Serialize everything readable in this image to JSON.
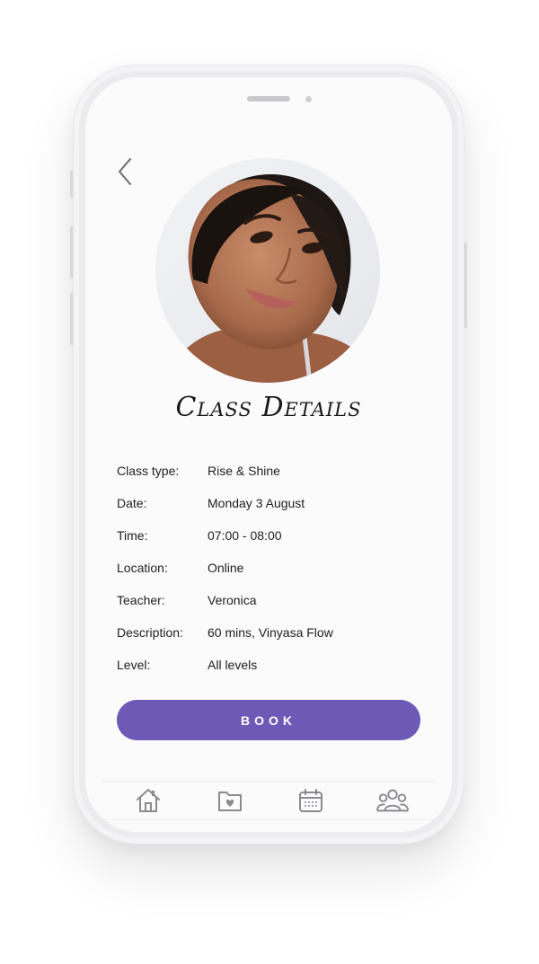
{
  "screen": {
    "title": "Class Details",
    "back_icon": "chevron-left-icon"
  },
  "details": [
    {
      "label": "Class type:",
      "value": "Rise & Shine"
    },
    {
      "label": "Date:",
      "value": "Monday 3 August"
    },
    {
      "label": "Time:",
      "value": "07:00 - 08:00"
    },
    {
      "label": "Location:",
      "value": "Online"
    },
    {
      "label": "Teacher:",
      "value": "Veronica"
    },
    {
      "label": "Description:",
      "value": "60 mins, Vinyasa Flow"
    },
    {
      "label": "Level:",
      "value": "All levels"
    }
  ],
  "actions": {
    "book_label": "BOOK"
  },
  "tabbar": {
    "items": [
      {
        "icon": "home-icon"
      },
      {
        "icon": "favorites-folder-icon"
      },
      {
        "icon": "calendar-icon"
      },
      {
        "icon": "community-icon"
      }
    ]
  },
  "colors": {
    "accent": "#6e59b7",
    "text": "#1f1f1f",
    "icon": "#8a8a90"
  }
}
